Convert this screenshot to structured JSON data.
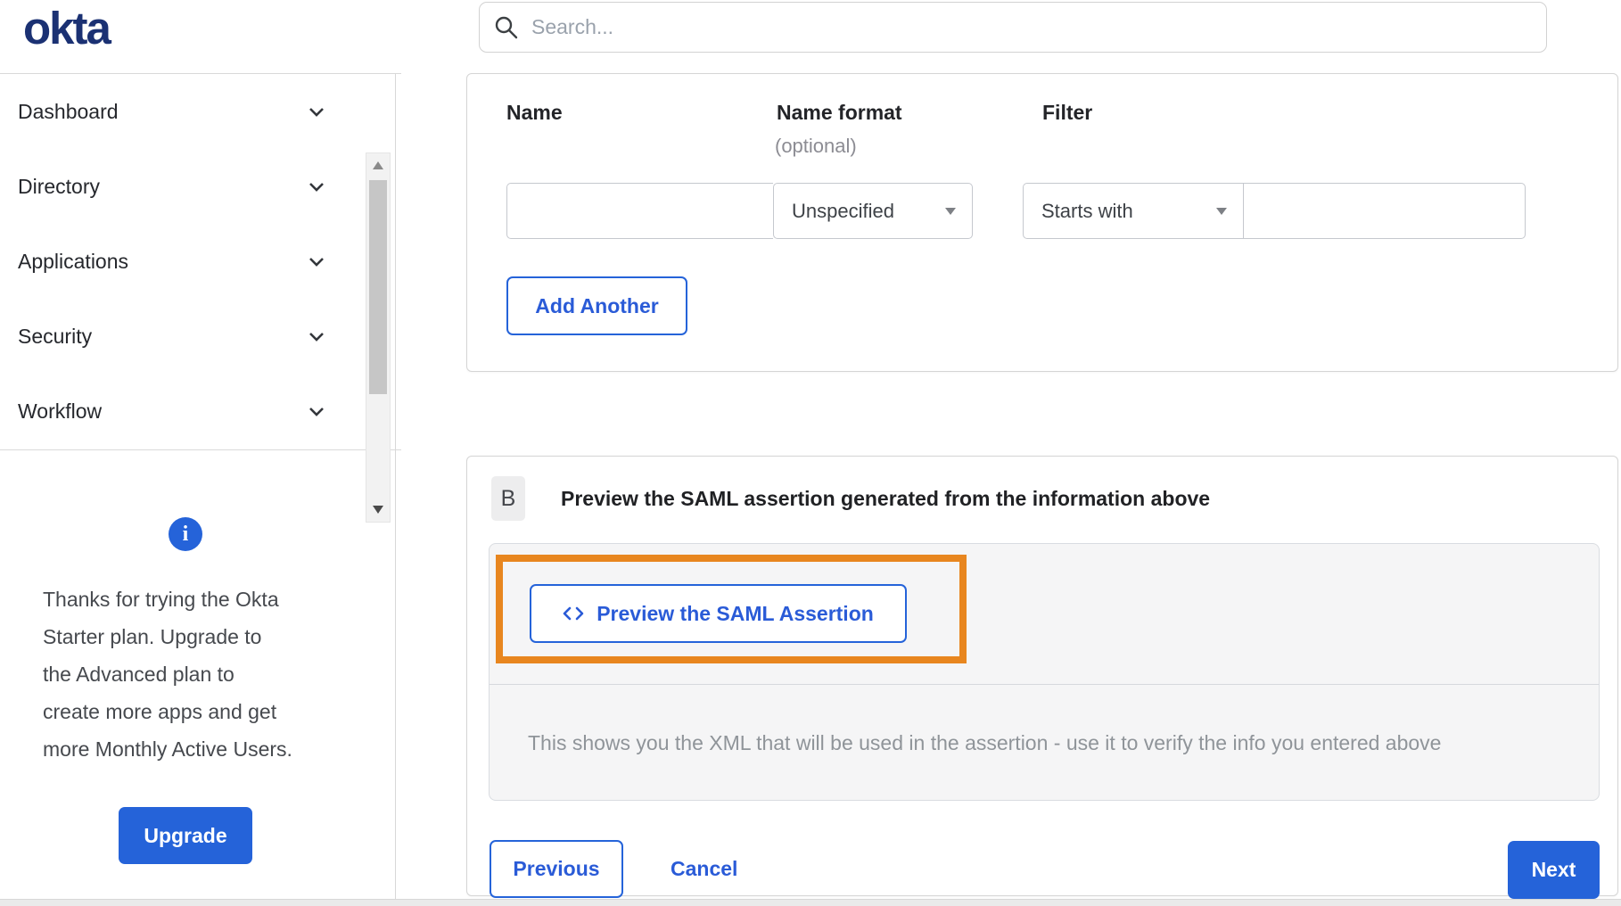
{
  "brand": {
    "logo_text": "okta"
  },
  "search": {
    "placeholder": "Search..."
  },
  "sidebar": {
    "items": [
      {
        "label": "Dashboard"
      },
      {
        "label": "Directory"
      },
      {
        "label": "Applications"
      },
      {
        "label": "Security"
      },
      {
        "label": "Workflow"
      }
    ],
    "trial": {
      "info_glyph": "i",
      "message_lines": [
        "Thanks for trying the Okta",
        "Starter plan. Upgrade to",
        "the Advanced plan to",
        "create more apps and get",
        "more Monthly Active Users."
      ],
      "upgrade_label": "Upgrade"
    }
  },
  "attribute_form": {
    "columns": {
      "name": "Name",
      "name_format": "Name format",
      "name_format_note": "(optional)",
      "filter": "Filter"
    },
    "row": {
      "name_value": "",
      "name_format_value": "Unspecified",
      "filter_type_value": "Starts with",
      "filter_value": ""
    },
    "add_another_label": "Add Another"
  },
  "preview_section": {
    "step_badge": "B",
    "heading": "Preview the SAML assertion generated from the information above",
    "preview_button_label": "Preview the SAML Assertion",
    "description": "This shows you the XML that will be used in the assertion - use it to verify the info you entered above"
  },
  "footer": {
    "previous_label": "Previous",
    "cancel_label": "Cancel",
    "next_label": "Next"
  },
  "colors": {
    "accent_blue": "#2563d9",
    "logo_navy": "#1b3173",
    "annotation_orange": "#e8861f"
  }
}
